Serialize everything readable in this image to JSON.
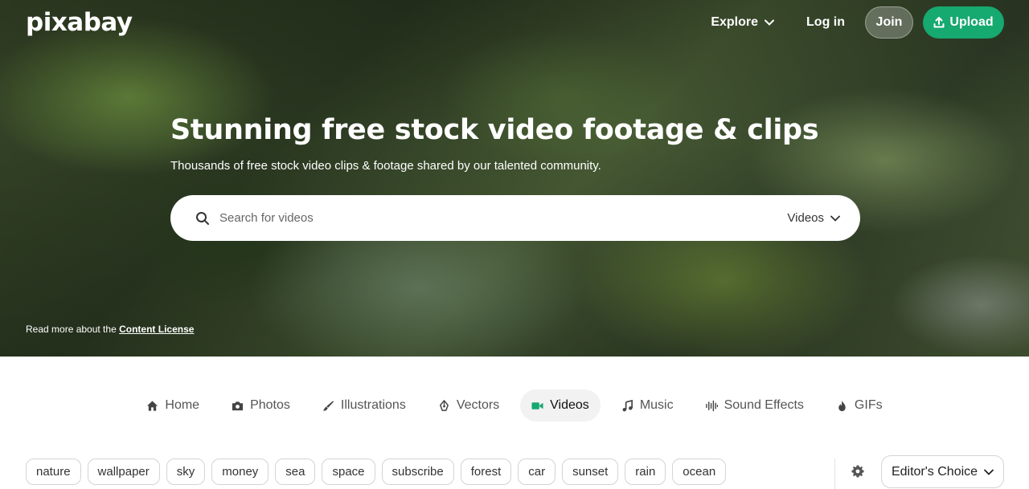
{
  "brand": {
    "logo": "pixabay",
    "accent": "#16a970"
  },
  "nav": {
    "explore": "Explore",
    "login": "Log in",
    "join": "Join",
    "upload": "Upload"
  },
  "hero": {
    "title": "Stunning free stock video footage & clips",
    "subtitle": "Thousands of free stock video clips & footage shared by our talented community.",
    "search_placeholder": "Search for videos",
    "search_type": "Videos",
    "license_prefix": "Read more about the ",
    "license_link": "Content License"
  },
  "tabs": [
    {
      "label": "Home",
      "icon": "home-icon"
    },
    {
      "label": "Photos",
      "icon": "camera-icon"
    },
    {
      "label": "Illustrations",
      "icon": "brush-icon"
    },
    {
      "label": "Vectors",
      "icon": "pen-icon"
    },
    {
      "label": "Videos",
      "icon": "video-icon",
      "active": true
    },
    {
      "label": "Music",
      "icon": "music-icon"
    },
    {
      "label": "Sound Effects",
      "icon": "waveform-icon"
    },
    {
      "label": "GIFs",
      "icon": "flame-icon"
    }
  ],
  "chips": [
    "nature",
    "wallpaper",
    "sky",
    "money",
    "sea",
    "space",
    "subscribe",
    "forest",
    "car",
    "sunset",
    "rain",
    "ocean"
  ],
  "filter": {
    "sort": "Editor's Choice"
  }
}
